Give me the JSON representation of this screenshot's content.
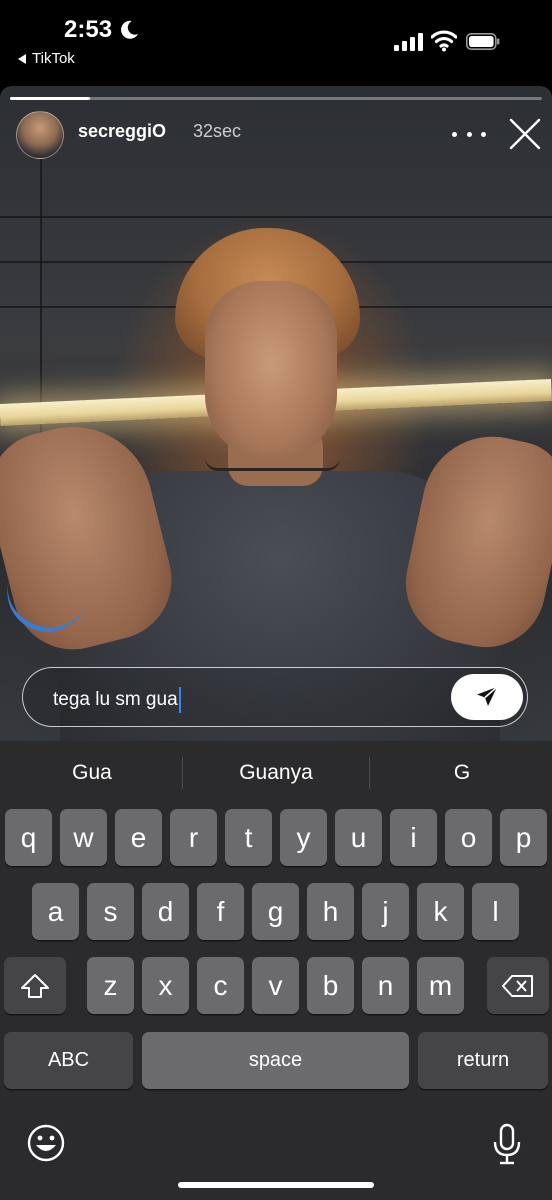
{
  "status_bar": {
    "time": "2:53",
    "back_app": "TikTok",
    "icons": [
      "moon-icon",
      "signal-icon",
      "wifi-icon",
      "battery-icon"
    ]
  },
  "story": {
    "username": "secreggiO",
    "age": "32sec",
    "progress_fraction": 0.15,
    "icons": [
      "avatar",
      "more-icon",
      "close-icon"
    ]
  },
  "reply": {
    "value": "tega lu sm gua",
    "send_icon": "send-icon"
  },
  "keyboard": {
    "suggestions": [
      "Gua",
      "Guanya",
      "G"
    ],
    "row1": [
      "q",
      "w",
      "e",
      "r",
      "t",
      "y",
      "u",
      "i",
      "o",
      "p"
    ],
    "row2": [
      "a",
      "s",
      "d",
      "f",
      "g",
      "h",
      "j",
      "k",
      "l"
    ],
    "row3": [
      "z",
      "x",
      "c",
      "v",
      "b",
      "n",
      "m"
    ],
    "shift_icon": "shift-icon",
    "delete_icon": "delete-icon",
    "abc_label": "ABC",
    "space_label": "space",
    "return_label": "return",
    "emoji_icon": "emoji-icon",
    "mic_icon": "microphone-icon"
  },
  "colors": {
    "caret": "#3a82f7",
    "keyboard_bg": "#2b2b2d",
    "key_bg": "#6b6b6e",
    "fn_key_bg": "#454548"
  }
}
